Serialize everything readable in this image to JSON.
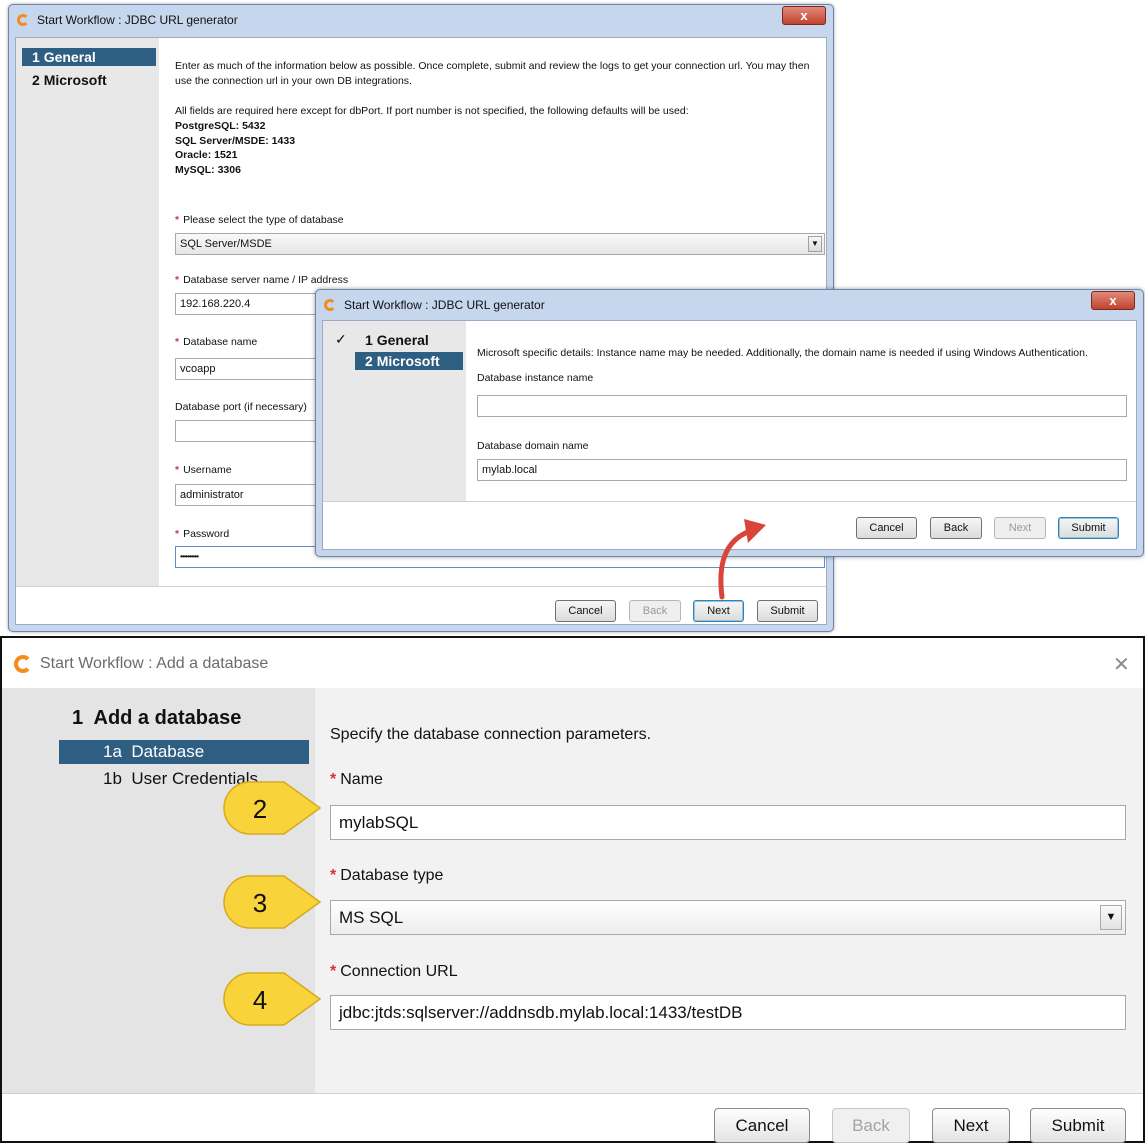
{
  "win1": {
    "title": "Start Workflow : JDBC URL generator",
    "close_glyph": "x",
    "steps": [
      {
        "num": "1",
        "label": "General"
      },
      {
        "num": "2",
        "label": "Microsoft"
      }
    ],
    "intro": "Enter as much of the information below as possible. Once complete, submit and review the logs to get your connection url. You may then use the connection url in your own DB integrations.",
    "defaults_note": "All fields are required here except for dbPort. If port number is not specified, the following defaults will be used:",
    "defaults": [
      "PostgreSQL: 5432",
      "SQL Server/MSDE: 1433",
      "Oracle: 1521",
      "MySQL: 3306"
    ],
    "fields": {
      "db_type_label": "Please select the type of database",
      "db_type_value": "SQL Server/MSDE",
      "server_label": "Database server name / IP address",
      "server_value": "192.168.220.4",
      "dbname_label": "Database name",
      "dbname_value": "vcoapp",
      "port_label": "Database port (if necessary)",
      "port_value": "",
      "username_label": "Username",
      "username_value": "administrator",
      "password_label": "Password",
      "password_value": "••••••••••"
    },
    "buttons": {
      "cancel": "Cancel",
      "back": "Back",
      "next": "Next",
      "submit": "Submit"
    }
  },
  "win2": {
    "title": "Start Workflow : JDBC URL generator",
    "close_glyph": "x",
    "steps": [
      {
        "num": "1",
        "label": "General",
        "check": "✓"
      },
      {
        "num": "2",
        "label": "Microsoft"
      }
    ],
    "intro": "Microsoft specific details: Instance name may be needed. Additionally, the domain name is needed if using Windows Authentication.",
    "instance_label": "Database instance name",
    "instance_value": "",
    "domain_label": "Database domain name",
    "domain_value": "mylab.local",
    "buttons": {
      "cancel": "Cancel",
      "back": "Back",
      "next": "Next",
      "submit": "Submit"
    }
  },
  "win3": {
    "title": "Start Workflow : Add a database",
    "close_glyph": "✕",
    "section": "1  Add a database",
    "steps": [
      {
        "num": "1a",
        "label": "Database"
      },
      {
        "num": "1b",
        "label": "User Credentials"
      }
    ],
    "intro": "Specify the database connection parameters.",
    "name_label": "Name",
    "name_value": "mylabSQL",
    "type_label": "Database type",
    "type_value": "MS SQL",
    "url_label": "Connection URL",
    "url_value": "jdbc:jtds:sqlserver://addnsdb.mylab.local:1433/testDB",
    "required_mark": "*",
    "callouts": [
      "2",
      "3",
      "4"
    ],
    "buttons": {
      "cancel": "Cancel",
      "back": "Back",
      "next": "Next",
      "submit": "Submit"
    }
  },
  "colors": {
    "accent_blue": "#2f5e83",
    "required_red": "#d4343c",
    "callout_yellow": "#f9d33a",
    "arrow_red": "#d9453a",
    "logo_orange": "#f28c1b"
  }
}
